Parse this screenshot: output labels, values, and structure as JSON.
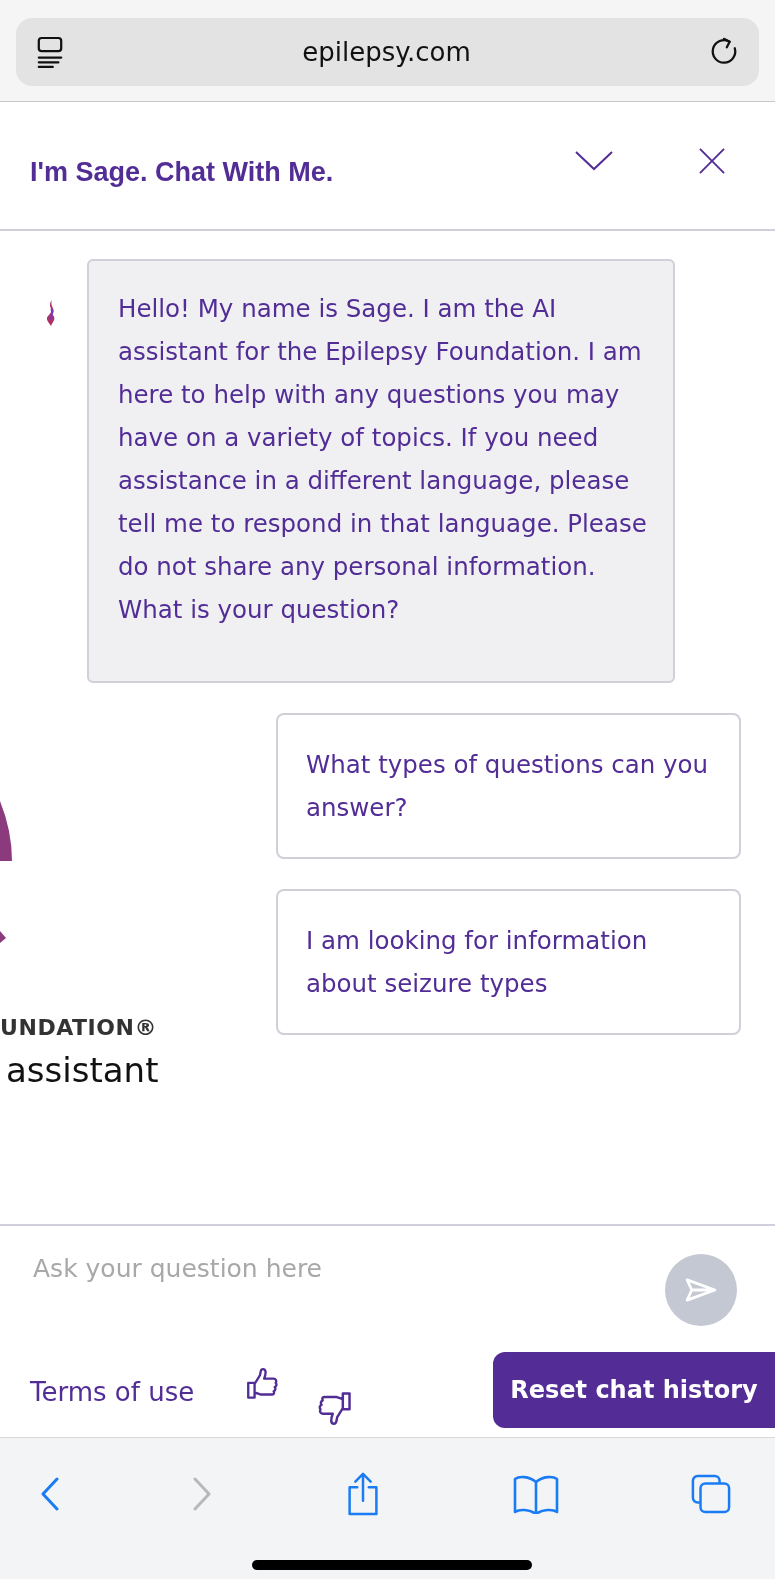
{
  "browser": {
    "url": "epilepsy.com",
    "nav": [
      {
        "kind": "back",
        "disabled": false
      },
      {
        "kind": "forward",
        "disabled": true
      },
      {
        "kind": "share",
        "disabled": false
      },
      {
        "kind": "bookmarks",
        "disabled": false
      },
      {
        "kind": "tabs",
        "disabled": false
      }
    ]
  },
  "chat": {
    "title": "I'm Sage. Chat With Me.",
    "messages": [
      {
        "text": "Hello! My name is Sage. I am the AI assistant for the Epilepsy Foundation. I am here to help with any questions you may have on a variety of topics. If you need assistance in a different language, please tell me to respond in that language. Please do not share any personal information. What is your question?"
      }
    ],
    "background_logo": {
      "line_1": "UNDATION®",
      "line_2": "assistant"
    },
    "suggestions": [
      "What types of questions can you answer?",
      "I am looking for information about seizure types"
    ],
    "input": {
      "placeholder": "Ask your question here"
    },
    "send_button": {
      "disabled": true
    },
    "terms_link": "Terms of use",
    "reset_button": "Reset chat history"
  }
}
